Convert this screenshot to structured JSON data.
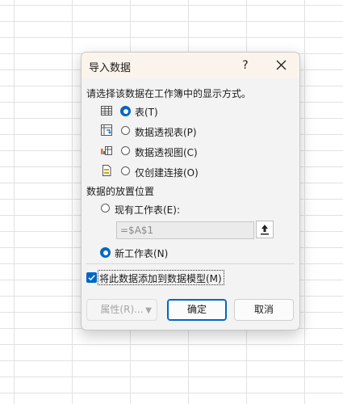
{
  "dialog": {
    "title": "导入数据",
    "help_label": "?",
    "prompt": "请选择该数据在工作簿中的显示方式。",
    "view_options": [
      {
        "label": "表(T)",
        "icon": "table-icon",
        "checked": true
      },
      {
        "label": "数据透视表(P)",
        "icon": "pivot-table-icon",
        "checked": false
      },
      {
        "label": "数据透视图(C)",
        "icon": "pivot-chart-icon",
        "checked": false
      },
      {
        "label": "仅创建连接(O)",
        "icon": "connection-only-icon",
        "checked": false
      }
    ],
    "location_heading": "数据的放置位置",
    "existing_sheet_label": "现有工作表(E):",
    "cell_reference_value": "=$A$1",
    "new_sheet_label": "新工作表(N)",
    "data_model_label": "将此数据添加到数据模型(M)",
    "data_model_checked": true,
    "buttons": {
      "properties": "属性(R)...",
      "ok": "确定",
      "cancel": "取消"
    }
  },
  "colors": {
    "accent": "#0067c0",
    "title_bar": "#fbf4ec",
    "dialog_bg": "#f3f3f3"
  }
}
